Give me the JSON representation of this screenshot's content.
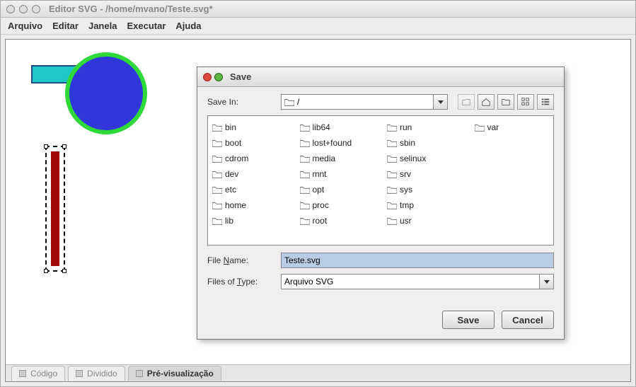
{
  "window": {
    "title": "Editor SVG - /home/mvano/Teste.svg*"
  },
  "menubar": {
    "items": [
      "Arquivo",
      "Editar",
      "Janela",
      "Executar",
      "Ajuda"
    ]
  },
  "tabs": {
    "items": [
      {
        "label": "Código",
        "active": false
      },
      {
        "label": "Dividido",
        "active": false
      },
      {
        "label": "Pré-visualização",
        "active": true
      }
    ]
  },
  "dialog": {
    "title": "Save",
    "save_in_label": "Save In:",
    "save_in_value": "/",
    "folders_col1": [
      "bin",
      "boot",
      "cdrom",
      "dev",
      "etc",
      "home",
      "lib",
      "lib64"
    ],
    "folders_col2": [
      "lost+found",
      "media",
      "mnt",
      "opt",
      "proc",
      "root",
      "run",
      "sbin"
    ],
    "folders_col3": [
      "selinux",
      "srv",
      "sys",
      "tmp",
      "usr",
      "var"
    ],
    "file_name_label": "File Name:",
    "file_name_value": "Teste.svg",
    "file_type_label": "Files of Type:",
    "file_type_value": "Arquivo SVG",
    "save_btn": "Save",
    "cancel_btn": "Cancel"
  }
}
